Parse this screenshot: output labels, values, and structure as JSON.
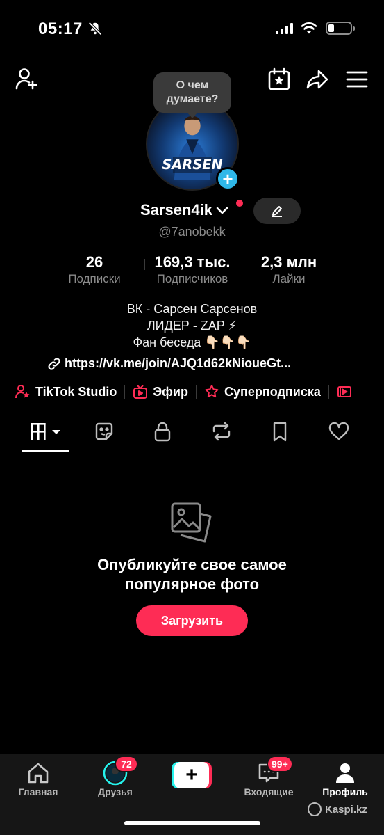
{
  "status_bar": {
    "time": "05:17",
    "battery_level": 0.25,
    "icons": [
      "bell-off-icon",
      "signal-icon",
      "wifi-icon",
      "battery-icon"
    ]
  },
  "header": {
    "icons": [
      "add-friend-icon",
      "calendar-star-icon",
      "share-icon",
      "menu-icon"
    ]
  },
  "profile": {
    "thought_bubble": "О чем думаете?",
    "avatar_text": "SARSEN",
    "display_name": "Sarsen4ik",
    "handle": "@7anobekk",
    "stats": [
      {
        "value": "26",
        "label": "Подписки"
      },
      {
        "value": "169,3 тыс.",
        "label": "Подписчиков"
      },
      {
        "value": "2,3 млн",
        "label": "Лайки"
      }
    ],
    "bio_lines": [
      "ВК - Сарсен Сарсенов",
      "ЛИДЕР - ZAP ⚡",
      "Фан беседа 👇🏻👇🏻👇🏻"
    ],
    "link": "https://vk.me/join/AJQ1d62kNioueGt..."
  },
  "chips": [
    {
      "label": "TikTok Studio",
      "icon": "studio-icon"
    },
    {
      "label": "Эфир",
      "icon": "live-tv-icon"
    },
    {
      "label": "Суперподписка",
      "icon": "superfollow-icon"
    }
  ],
  "tabs": [
    "videos-grid-icon",
    "reposts-sticker-icon",
    "private-lock-icon",
    "reposts-icon",
    "favorites-bookmark-icon",
    "liked-heart-icon"
  ],
  "empty_state": {
    "title_line1": "Опубликуйте свое самое",
    "title_line2": "популярное фото",
    "button": "Загрузить"
  },
  "bottom_nav": {
    "items": [
      {
        "label": "Главная"
      },
      {
        "label": "Друзья",
        "badge": "72"
      },
      {
        "label": ""
      },
      {
        "label": "Входящие",
        "badge": "99+"
      },
      {
        "label": "Профиль"
      }
    ]
  },
  "watermark": "Kaspi.kz",
  "colors": {
    "accent": "#fe2c55",
    "cyan": "#25f4ee",
    "background": "#000000",
    "muted": "#8a8a8a"
  }
}
